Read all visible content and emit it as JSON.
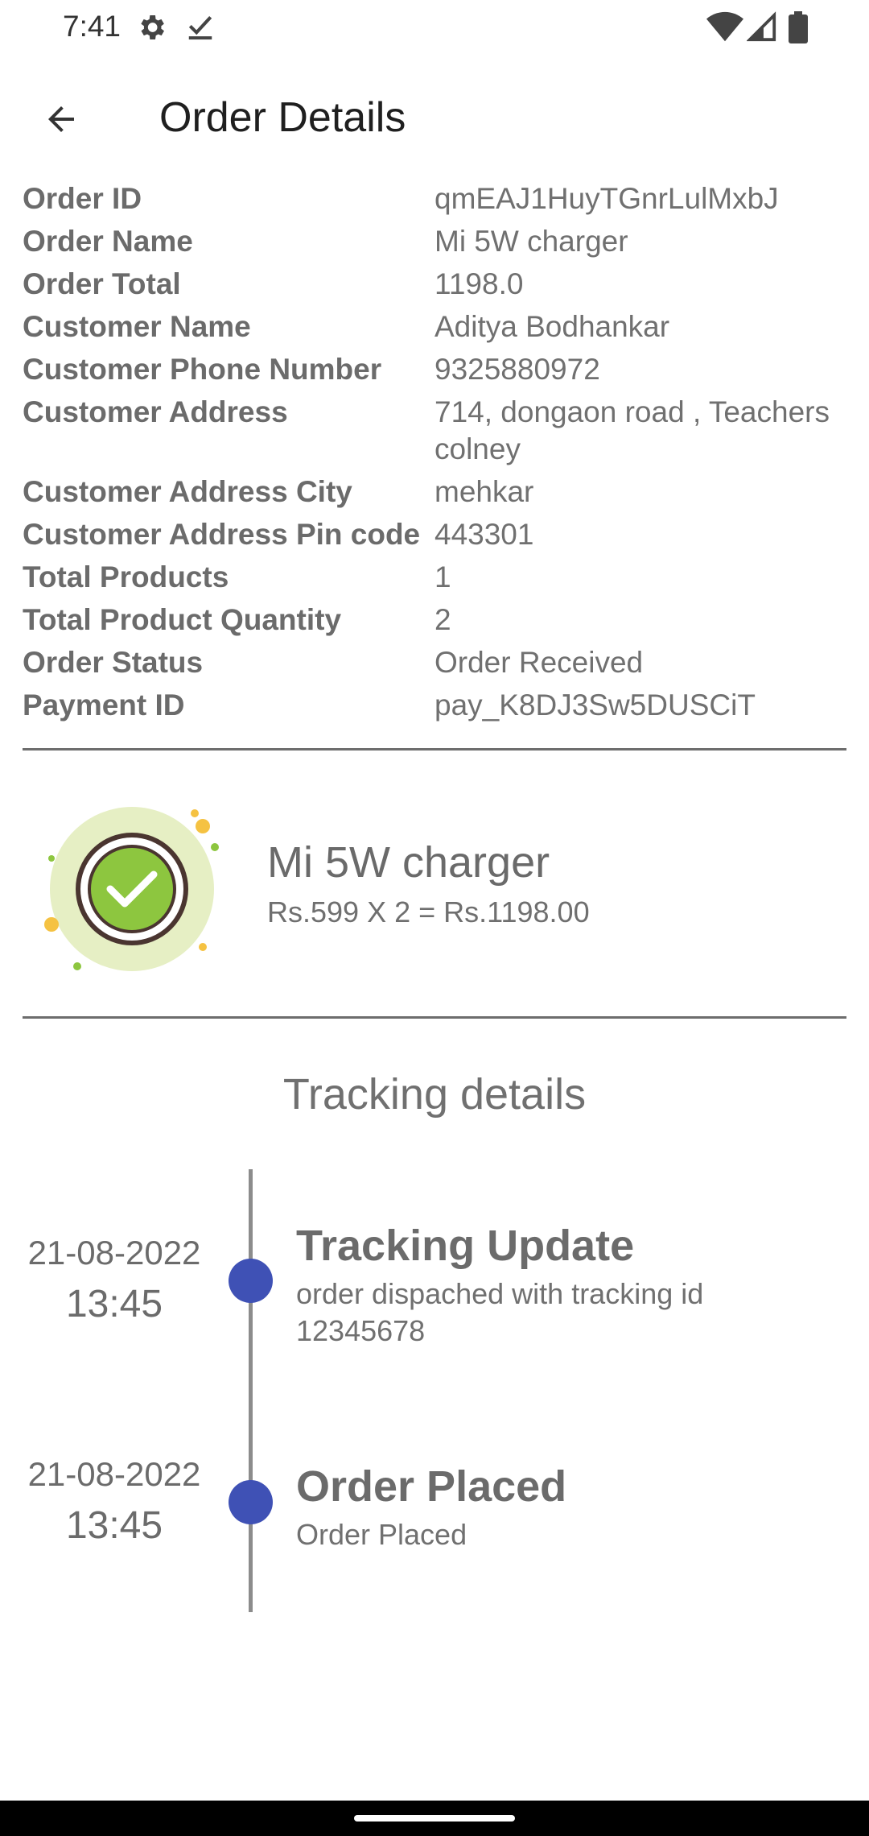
{
  "status_bar": {
    "time": "7:41",
    "icons": [
      "gear-icon",
      "check-icon",
      "wifi-icon",
      "signal-icon",
      "battery-icon"
    ]
  },
  "app_bar": {
    "title": "Order Details",
    "back_icon": "arrow-back-icon"
  },
  "details": [
    {
      "label": "Order ID",
      "value": "qmEAJ1HuyTGnrLulMxbJ"
    },
    {
      "label": "Order Name",
      "value": "Mi 5W charger"
    },
    {
      "label": "Order Total",
      "value": "1198.0"
    },
    {
      "label": "Customer Name",
      "value": "Aditya Bodhankar"
    },
    {
      "label": "Customer Phone Number",
      "value": "9325880972"
    },
    {
      "label": "Customer Address",
      "value": "714, dongaon road , Teachers colney"
    },
    {
      "label": "Customer Address City",
      "value": "mehkar"
    },
    {
      "label": "Customer Address Pin code",
      "value": "443301"
    },
    {
      "label": "Total Products",
      "value": "1"
    },
    {
      "label": "Total Product Quantity",
      "value": "2"
    },
    {
      "label": "Order Status",
      "value": "Order Received"
    },
    {
      "label": "Payment ID",
      "value": "pay_K8DJ3Sw5DUSCiT"
    }
  ],
  "product": {
    "name": "Mi 5W charger",
    "price_line": "Rs.599 X 2 = Rs.1198.00",
    "icon": "check-badge-icon"
  },
  "tracking": {
    "title": "Tracking details",
    "events": [
      {
        "date": "21-08-2022",
        "time": "13:45",
        "title": "Tracking Update",
        "description": "order dispached with tracking id 12345678"
      },
      {
        "date": "21-08-2022",
        "time": "13:45",
        "title": "Order Placed",
        "description": "Order Placed"
      }
    ]
  },
  "colors": {
    "accent": "#3f51b5",
    "badge_green": "#8dc63f",
    "badge_ring": "#e6efc4",
    "text_gray": "#6b6b6b"
  }
}
